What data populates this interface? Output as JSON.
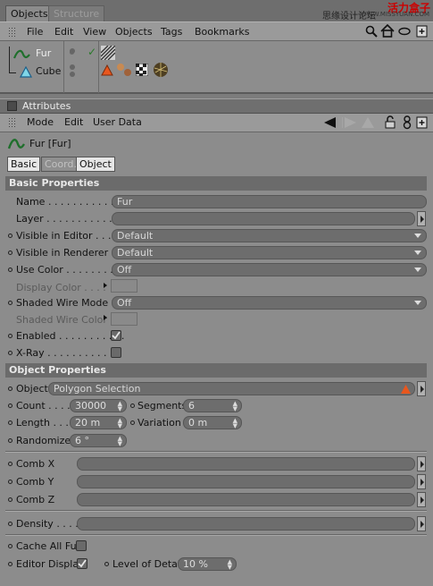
{
  "tabs": {
    "objects": "Objects",
    "structure": "Structure"
  },
  "watermark": {
    "line1": "思缘设计论坛",
    "line2": "WWW.MISSYUAN.COM",
    "brand": "活力盒子",
    "brand2": "OLIHE.COM"
  },
  "menu": {
    "file": "File",
    "edit": "Edit",
    "view": "View",
    "objects": "Objects",
    "tags": "Tags",
    "bookmarks": "Bookmarks"
  },
  "tree": {
    "fur": "Fur",
    "cube": "Cube"
  },
  "attributes": {
    "title": "Attributes"
  },
  "attrmenu": {
    "mode": "Mode",
    "edit": "Edit",
    "userdata": "User Data"
  },
  "object_name": "Fur [Fur]",
  "subtabs": {
    "basic": "Basic",
    "coord": "Coord.",
    "object": "Object"
  },
  "basic": {
    "section": "Basic Properties",
    "name_label": "Name . . . . . . . . . . . .",
    "name_value": "Fur",
    "layer_label": "Layer . . . . . . . . . . . .",
    "vis_editor_label": "Visible in Editor . . . . .",
    "vis_editor_value": "Default",
    "vis_renderer_label": "Visible in Renderer . .",
    "vis_renderer_value": "Default",
    "use_color_label": "Use Color . . . . . . . . . .",
    "use_color_value": "Off",
    "display_color_label": "Display Color  . . . .",
    "shaded_wire_mode_label": "Shaded Wire Mode",
    "shaded_wire_mode_value": "Off",
    "shaded_wire_color_label": "Shaded Wire Color",
    "enabled_label": "Enabled . . . . . . . . . . .",
    "xray_label": "X-Ray . . . . . . . . . . . ."
  },
  "object": {
    "section": "Object Properties",
    "object_label": "Object",
    "object_value": "Polygon Selection",
    "count_label": "Count . . . .",
    "count_value": "30000",
    "segments_label": "Segments",
    "segments_value": "6",
    "length_label": "Length . . .",
    "length_value": "20 m",
    "variation_label": "Variation",
    "variation_value": "0 m",
    "randomize_label": "Randomize",
    "randomize_value": "6 °",
    "combx_label": "Comb X",
    "comby_label": "Comb Y",
    "combz_label": "Comb Z",
    "density_label": "Density . . . . .",
    "cache_label": "Cache All Fur",
    "editor_display_label": "Editor Display",
    "lod_label": "Level of Detail",
    "lod_value": "10 %"
  }
}
